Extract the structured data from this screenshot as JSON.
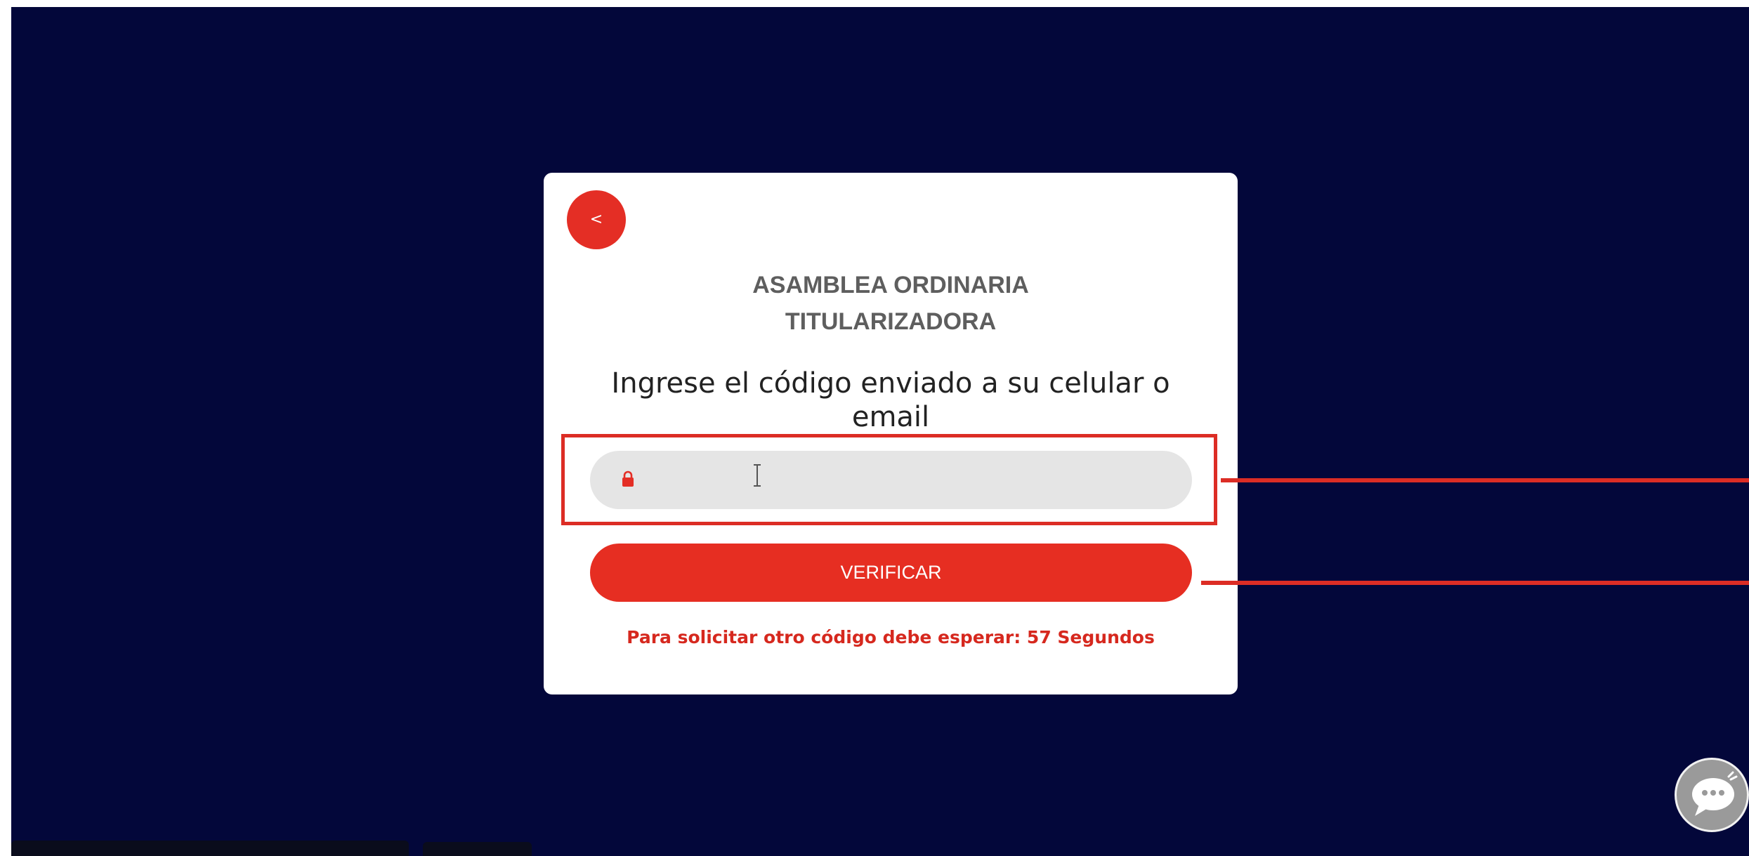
{
  "card": {
    "back_label": "<",
    "title_line1": "ASAMBLEA ORDINARIA",
    "title_line2": "TITULARIZADORA",
    "prompt": "Ingrese el código enviado a su celular o email",
    "code_input": {
      "value": "",
      "placeholder": ""
    },
    "verify_label": "VERIFICAR",
    "countdown": "Para solicitar otro código debe esperar: 57 Segundos"
  },
  "icons": {
    "back": "chevron-left-icon",
    "lock": "lock-icon",
    "chat": "chat-bubble-icon",
    "cursor": "text-cursor-icon"
  },
  "colors": {
    "background": "#03073a",
    "accent": "#e62e22",
    "field": "#e5e5e5",
    "title": "#5e5e5e",
    "annotation": "#dc2d25"
  }
}
